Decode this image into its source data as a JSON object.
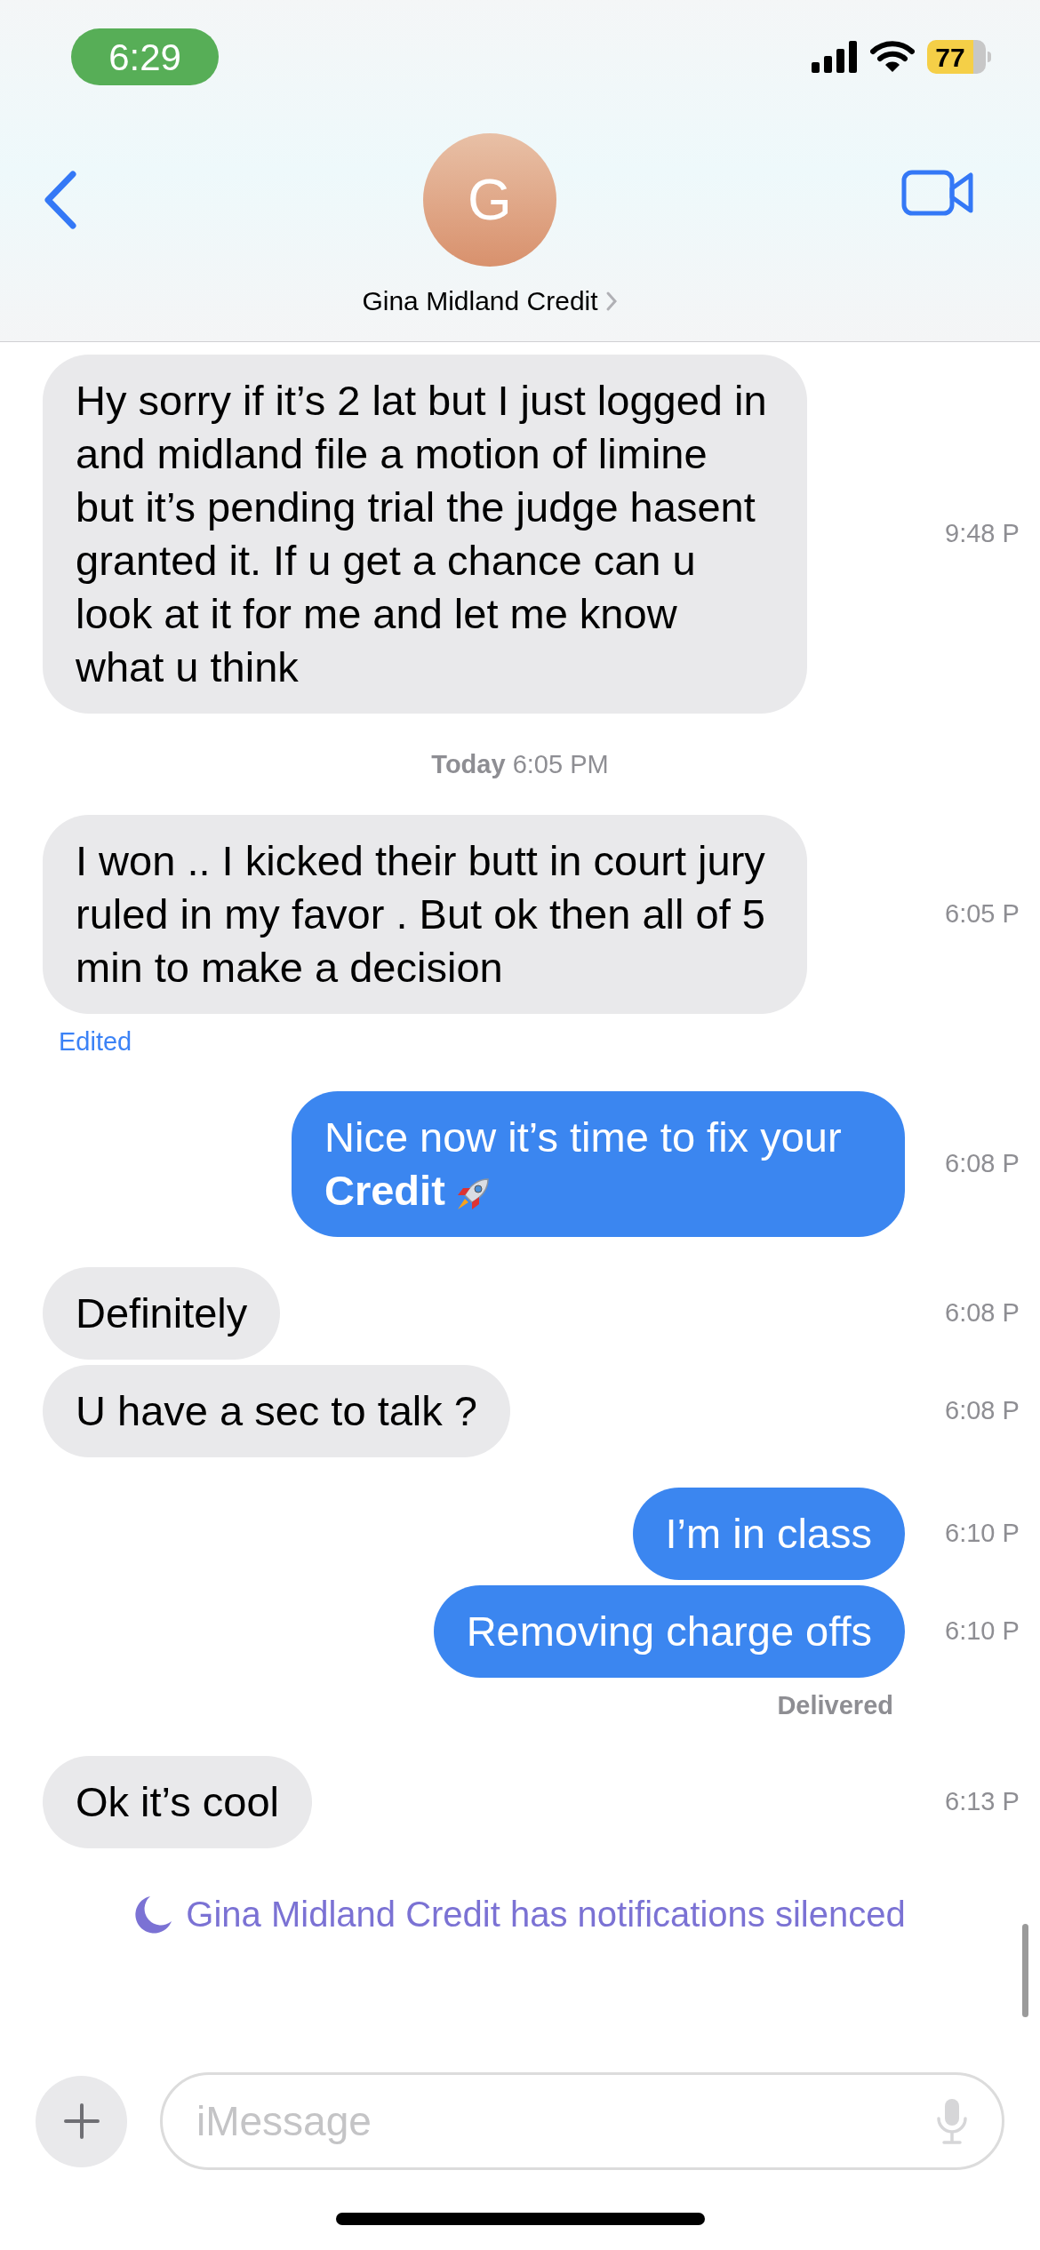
{
  "status_bar": {
    "time": "6:29",
    "battery": "77"
  },
  "header": {
    "avatar_initial": "G",
    "contact_name": "Gina Midland Credit"
  },
  "messages": [
    {
      "kind": "incoming",
      "text": "Hy sorry if it’s 2 lat but I just logged in and midland file a motion of limine but it’s pending trial the judge hasent granted it. If u get a chance can u look at it for me and let me know what u think",
      "time": "9:48 P"
    },
    {
      "kind": "divider",
      "text": "**Today** 6:05 PM"
    },
    {
      "kind": "incoming",
      "text": "I won .. I kicked their butt in court jury ruled in my favor .  But ok then all of 5 min to make a decision",
      "time": "6:05 P"
    },
    {
      "kind": "note",
      "text": "Edited"
    },
    {
      "kind": "outgoing",
      "text": "Nice now it’s time to fix your **Credit**",
      "rocket": true,
      "time": "6:08 P"
    },
    {
      "kind": "incoming",
      "text": "Definitely",
      "time": "6:08 P"
    },
    {
      "kind": "incoming",
      "text": "U have a sec to talk ?",
      "time": "6:08 P"
    },
    {
      "kind": "outgoing",
      "text": "I’m in class",
      "time": "6:10 P"
    },
    {
      "kind": "outgoing",
      "text": "Removing charge offs",
      "time": "6:10 P"
    },
    {
      "kind": "status",
      "text": "Delivered"
    },
    {
      "kind": "incoming",
      "text": "Ok it’s cool",
      "time": "6:13 P"
    }
  ],
  "silenced_notice": "Gina Midland Credit has notifications silenced",
  "composer": {
    "placeholder": "iMessage"
  }
}
